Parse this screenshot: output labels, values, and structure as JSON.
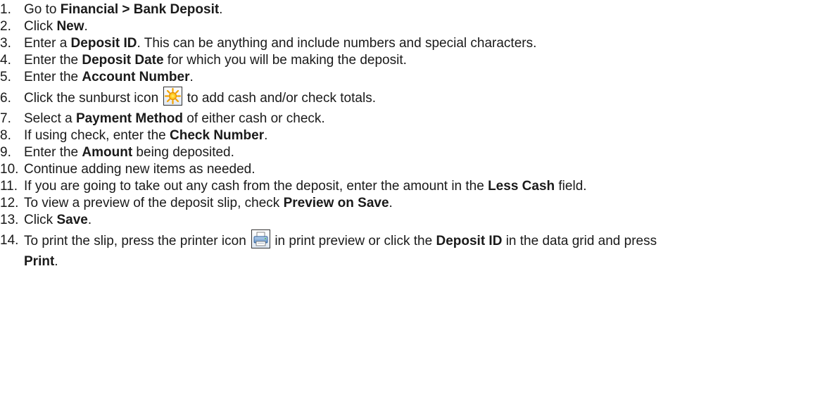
{
  "steps": [
    {
      "num": "1.",
      "parts": [
        "Go to ",
        "Financial > Bank Deposit",
        "."
      ]
    },
    {
      "num": "2.",
      "parts": [
        "Click ",
        "New",
        "."
      ]
    },
    {
      "num": "3.",
      "parts": [
        "Enter a ",
        "Deposit ID",
        ". This can be anything and include numbers and special characters."
      ]
    },
    {
      "num": "4.",
      "parts": [
        "Enter the ",
        "Deposit Date",
        " for which you will be making the deposit."
      ]
    },
    {
      "num": "5.",
      "parts": [
        "Enter the ",
        "Account Number",
        "."
      ]
    },
    {
      "num": "6.",
      "parts": [
        "Click the sunburst icon ",
        " to add cash and/or check totals."
      ],
      "icon": "sunburst-icon"
    },
    {
      "num": "7.",
      "parts": [
        "Select a ",
        "Payment Method",
        " of either cash or check."
      ]
    },
    {
      "num": "8.",
      "parts": [
        "If using check, enter the ",
        "Check Number",
        "."
      ]
    },
    {
      "num": "9.",
      "parts": [
        "Enter the ",
        "Amount",
        " being deposited."
      ]
    },
    {
      "num": "10.",
      "parts": [
        "Continue adding new items as needed."
      ]
    },
    {
      "num": "11.",
      "parts": [
        "If you are going to take out any cash from the deposit, enter the amount in the ",
        "Less Cash",
        " field."
      ]
    },
    {
      "num": "12.",
      "parts": [
        "To view a preview of the deposit slip, check ",
        "Preview on Save",
        "."
      ]
    },
    {
      "num": "13.",
      "parts": [
        "Click ",
        "Save",
        "."
      ]
    },
    {
      "num": "14.",
      "parts": [
        "To print the slip, press the printer icon ",
        " in print preview or click the ",
        "Deposit ID",
        " in the data grid and press ",
        "Print",
        "."
      ],
      "icon": "printer-icon"
    }
  ]
}
